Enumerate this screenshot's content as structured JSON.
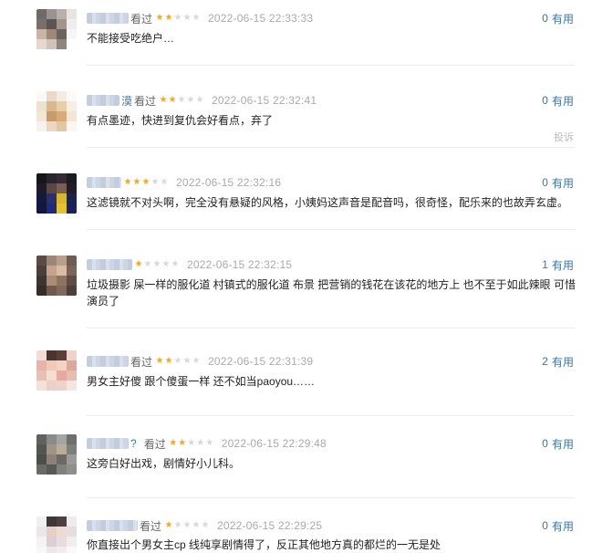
{
  "labels": {
    "watched": "看过",
    "useful": "有用",
    "report": "投诉"
  },
  "comments": [
    {
      "user_tail": "",
      "rating": 2,
      "time": "2022-06-15 22:33:33",
      "useful_count": "0",
      "text": "不能接受吃绝户…"
    },
    {
      "user_tail": "漠",
      "rating": 2,
      "time": "2022-06-15 22:32:41",
      "useful_count": "0",
      "text": "有点墨迹，快进到复仇会好看点，弃了"
    },
    {
      "user_tail": "",
      "rating": 3,
      "time": "2022-06-15 22:32:16",
      "useful_count": "0",
      "text": "这滤镜就不对头啊，完全没有悬疑的风格，小姨妈这声音是配音吗，很奇怪，配乐来的也故弄玄虚。"
    },
    {
      "user_tail": "",
      "rating": 1,
      "time": "2022-06-15 22:32:15",
      "useful_count": "1",
      "text": "垃圾摄影 屎一样的服化道 村镇式的服化道 布景 把营销的钱花在该花的地方上 也不至于如此辣眼 可惜演员了"
    },
    {
      "user_tail": "",
      "rating": 2,
      "time": "2022-06-15 22:31:39",
      "useful_count": "2",
      "text": "男女主好傻 跟个傻蛋一样 还不如当paoyou……"
    },
    {
      "user_tail": "?",
      "rating": 2,
      "time": "2022-06-15 22:29:48",
      "useful_count": "0",
      "text": "这旁白好出戏，剧情好小儿科。"
    },
    {
      "user_tail": "",
      "rating": 1,
      "time": "2022-06-15 22:29:25",
      "useful_count": "0",
      "text": "你直接出个男女主cp 线纯享剧情得了，反正其他地方真的都烂的一无是处"
    }
  ],
  "colors": {
    "link": "#3377aa",
    "star_on": "#f5a623",
    "star_off": "#d8d8d8",
    "time": "#aaaaaa"
  }
}
